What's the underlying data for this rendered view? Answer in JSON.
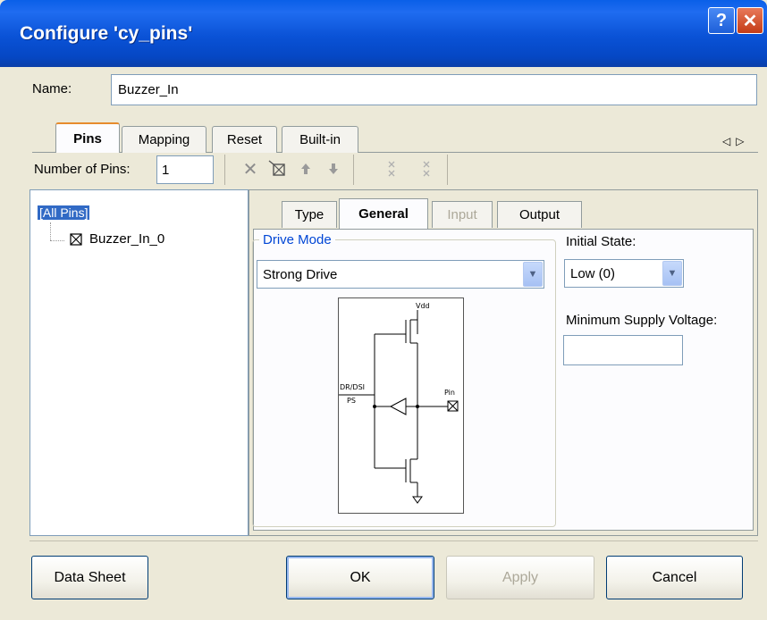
{
  "window": {
    "title": "Configure 'cy_pins'",
    "help_glyph": "?",
    "close_glyph": "✕"
  },
  "name_field": {
    "label": "Name:",
    "value": "Buzzer_In"
  },
  "tabs": [
    {
      "label": "Pins",
      "active": true
    },
    {
      "label": "Mapping"
    },
    {
      "label": "Reset"
    },
    {
      "label": "Built-in"
    }
  ],
  "tab_scroll": {
    "left": "◁",
    "right": "▷"
  },
  "pins_toolbar": {
    "number_label": "Number of Pins:",
    "number_value": "1",
    "icons": [
      "delete-icon",
      "pin-icon",
      "move-up-icon",
      "move-down-icon",
      "delete-all-icon",
      "move-all-icon"
    ]
  },
  "tree": {
    "root": "[All Pins]",
    "items": [
      {
        "label": "Buzzer_In_0"
      }
    ]
  },
  "inner_tabs": [
    {
      "label": "Type"
    },
    {
      "label": "General",
      "active": true
    },
    {
      "label": "Input",
      "disabled": true
    },
    {
      "label": "Output"
    }
  ],
  "drive_mode": {
    "group_title": "Drive Mode",
    "selected": "Strong Drive",
    "diagram_labels": {
      "vdd": "Vdd",
      "drive_in": "DR/DSI",
      "ps": "PS",
      "pin": "Pin"
    }
  },
  "initial_state": {
    "label": "Initial State:",
    "selected": "Low (0)"
  },
  "min_supply": {
    "label": "Minimum Supply Voltage:",
    "value": ""
  },
  "buttons": {
    "datasheet": "Data Sheet",
    "ok": "OK",
    "apply": "Apply",
    "cancel": "Cancel"
  },
  "colors": {
    "titlebar": "#0a52d6",
    "selection": "#316ac5",
    "group_title": "#0046d5"
  }
}
